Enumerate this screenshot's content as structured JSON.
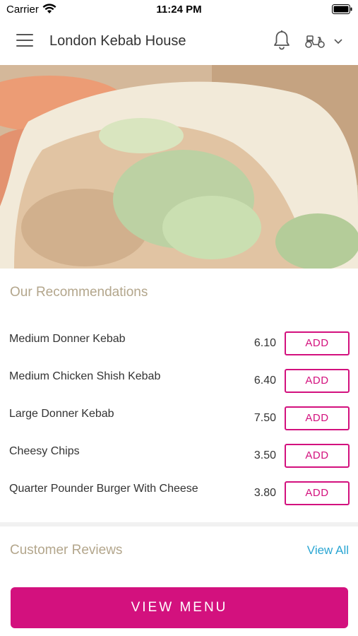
{
  "status_bar": {
    "carrier": "Carrier",
    "time": "11:24 PM",
    "icons": [
      "wifi-icon",
      "battery-icon"
    ]
  },
  "header": {
    "title": "London Kebab House",
    "icons": [
      "menu-icon",
      "bell-icon",
      "scooter-icon",
      "chevron-down-icon"
    ]
  },
  "hero": {
    "image": "kebab wrap photo"
  },
  "recommendations": {
    "title": "Our Recommendations",
    "items": [
      {
        "name": "Medium Donner Kebab",
        "price": "6.10",
        "action": "ADD"
      },
      {
        "name": "Medium Chicken Shish Kebab",
        "price": "6.40",
        "action": "ADD"
      },
      {
        "name": "Large Donner Kebab",
        "price": "7.50",
        "action": "ADD"
      },
      {
        "name": "Cheesy Chips",
        "price": "3.50",
        "action": "ADD"
      },
      {
        "name": "Quarter Pounder Burger With Cheese",
        "price": "3.80",
        "action": "ADD"
      }
    ]
  },
  "reviews": {
    "title": "Customer Reviews",
    "view_all": "View All"
  },
  "footer": {
    "view_menu": "VIEW MENU"
  },
  "colors": {
    "accent": "#d3117e",
    "section_title": "#b3a68c",
    "link": "#2ba6d3"
  }
}
